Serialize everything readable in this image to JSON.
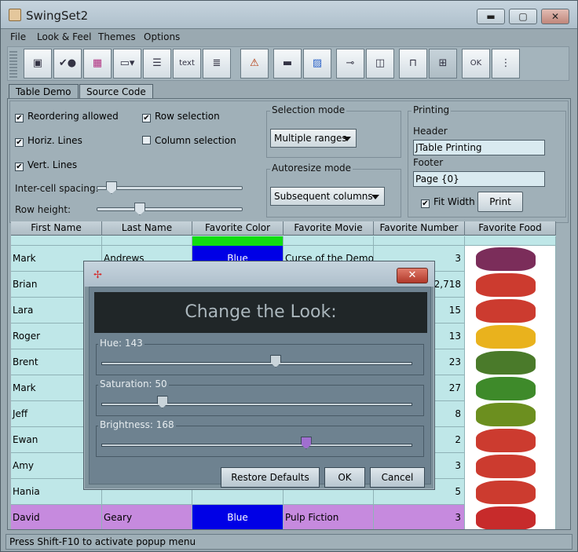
{
  "window": {
    "title": "SwingSet2"
  },
  "window_controls": {
    "minimize": "▬",
    "maximize": "▢",
    "close": "✕"
  },
  "menu": [
    "File",
    "Look & Feel",
    "Themes",
    "Options"
  ],
  "toolbar": {
    "icons": [
      "internal-frame-demo-icon",
      "button-demo-icon",
      "color-chooser-icon",
      "combobox-demo-icon",
      "file-chooser-icon",
      "html-text-icon",
      "list-demo-icon",
      "option-pane-icon",
      "progress-bar-icon",
      "scroll-pane-icon",
      "slider-demo-icon",
      "split-pane-icon",
      "tabbed-pane-icon",
      "table-demo-icon",
      "tooltip-demo-icon",
      "tree-demo-icon"
    ]
  },
  "tabs": [
    "Table Demo",
    "Source Code"
  ],
  "controls": {
    "reordering": "Reordering allowed",
    "horiz_lines": "Horiz. Lines",
    "vert_lines": "Vert. Lines",
    "row_selection": "Row selection",
    "column_selection": "Column selection",
    "intercell_spacing": "Inter-cell spacing:",
    "row_height": "Row height:",
    "selection_mode_title": "Selection mode",
    "selection_mode_value": "Multiple ranges",
    "autoresize_title": "Autoresize mode",
    "autoresize_value": "Subsequent columns",
    "printing_title": "Printing",
    "header_label": "Header",
    "header_value": "JTable Printing",
    "footer_label": "Footer",
    "footer_value": "Page {0}",
    "fit_width": "Fit Width",
    "print_button": "Print"
  },
  "table": {
    "columns": [
      "First Name",
      "Last Name",
      "Favorite Color",
      "Favorite Movie",
      "Favorite Number",
      "Favorite Food"
    ],
    "rows": [
      {
        "first": "Mark",
        "last": "Andrews",
        "color_name": "Blue",
        "color": "#0000e6",
        "movie": "Curse of the Demon",
        "number": "3",
        "food": "#7b2d5a"
      },
      {
        "first": "Brian",
        "last": "",
        "color_name": "",
        "color": "",
        "movie": "",
        "number": "2,718",
        "food": "#cc3b2f"
      },
      {
        "first": "Lara",
        "last": "",
        "color_name": "",
        "color": "",
        "movie": "",
        "number": "15",
        "food": "#cc3b2f"
      },
      {
        "first": "Roger",
        "last": "",
        "color_name": "",
        "color": "",
        "movie": "",
        "number": "13",
        "food": "#e9b21d"
      },
      {
        "first": "Brent",
        "last": "",
        "color_name": "",
        "color": "",
        "movie": "",
        "number": "23",
        "food": "#4a7a2a"
      },
      {
        "first": "Mark",
        "last": "",
        "color_name": "",
        "color": "",
        "movie": "",
        "number": "27",
        "food": "#3e8a2a"
      },
      {
        "first": "Jeff",
        "last": "",
        "color_name": "",
        "color": "",
        "movie": "",
        "number": "8",
        "food": "#6c8f1f"
      },
      {
        "first": "Ewan",
        "last": "",
        "color_name": "",
        "color": "",
        "movie": "",
        "number": "2",
        "food": "#cc3b2f"
      },
      {
        "first": "Amy",
        "last": "",
        "color_name": "",
        "color": "",
        "movie": "",
        "number": "3",
        "food": "#cc3b2f"
      },
      {
        "first": "Hania",
        "last": "",
        "color_name": "",
        "color": "",
        "movie": "",
        "number": "5",
        "food": "#cc3b2f"
      },
      {
        "first": "David",
        "last": "Geary",
        "color_name": "Blue",
        "color": "#0000e6",
        "movie": "Pulp Fiction",
        "number": "3",
        "food": "#c72b2b"
      }
    ]
  },
  "status": "Press Shift-F10 to activate popup menu",
  "dialog": {
    "heading": "Change the Look:",
    "hue_label": "Hue: 143",
    "hue_value": 143,
    "saturation_label": "Saturation: 50",
    "saturation_value": 50,
    "brightness_label": "Brightness: 168",
    "brightness_value": 168,
    "restore_button": "Restore Defaults",
    "ok_button": "OK",
    "cancel_button": "Cancel",
    "close": "✕"
  }
}
